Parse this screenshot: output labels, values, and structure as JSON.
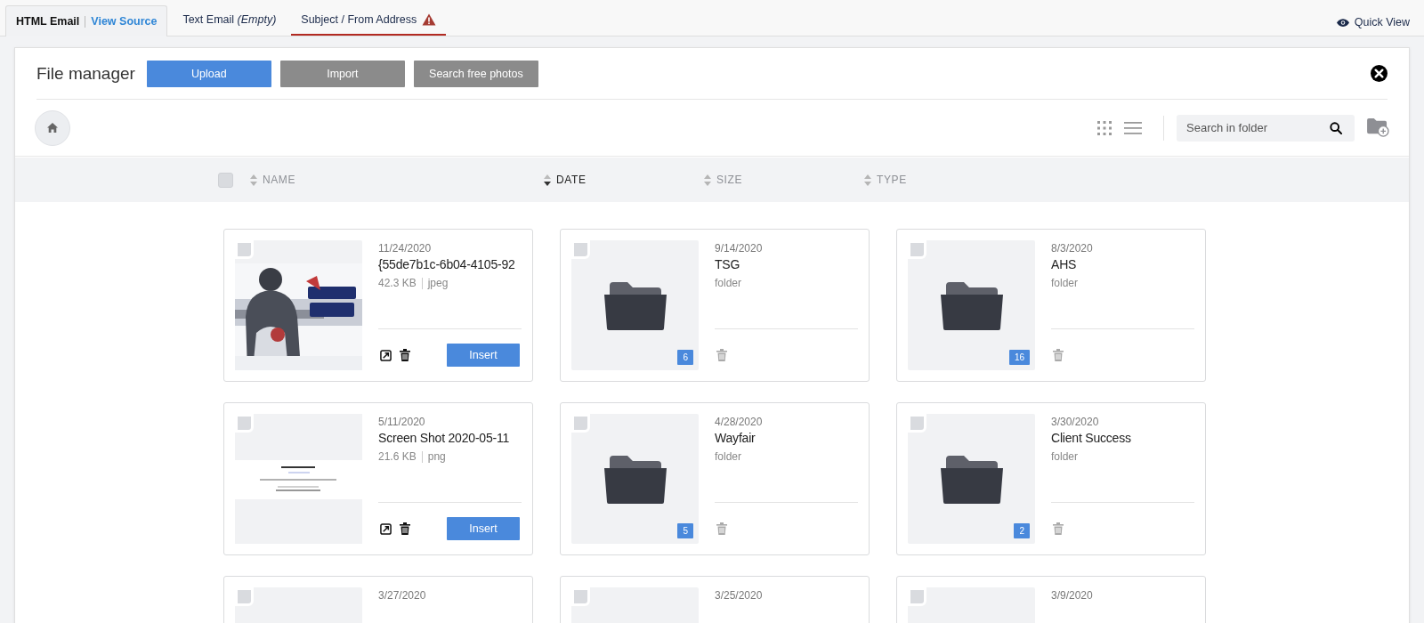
{
  "tabs": [
    {
      "label": "HTML Email",
      "link": "View Source",
      "selected": true,
      "warning": false
    },
    {
      "label": "Text Email *(Empty)*",
      "selected": false,
      "warning": false
    },
    {
      "label": "Subject / From Address",
      "selected": false,
      "warning": true
    }
  ],
  "quick_view": "Quick View",
  "file_manager": {
    "title": "File manager",
    "buttons": [
      {
        "label": "Upload",
        "kind": "primary"
      },
      {
        "label": "Import",
        "kind": "secondary"
      },
      {
        "label": "Search free photos",
        "kind": "secondary"
      }
    ],
    "search": {
      "placeholder": "Search in folder"
    },
    "select_all": {
      "checked": false
    },
    "columns": [
      {
        "label": "NAME",
        "selected": false
      },
      {
        "label": "DATE",
        "selected": true
      },
      {
        "label": "SIZE",
        "selected": false
      },
      {
        "label": "TYPE",
        "selected": false
      }
    ],
    "items": [
      {
        "kind": "file",
        "checked": false,
        "date": "11/24/2020",
        "name": "{55de7b1c-6b04-4105-92",
        "size": "42.3 KB",
        "type": "jpeg",
        "action": "Insert"
      },
      {
        "kind": "folder",
        "checked": false,
        "date": "9/14/2020",
        "name": "TSG",
        "type": "folder",
        "count": "6"
      },
      {
        "kind": "folder",
        "checked": false,
        "date": "8/3/2020",
        "name": "AHS",
        "type": "folder",
        "count": "16"
      },
      {
        "kind": "file",
        "checked": false,
        "date": "5/11/2020",
        "name": "Screen Shot 2020-05-11",
        "size": "21.6 KB",
        "type": "png",
        "action": "Insert"
      },
      {
        "kind": "folder",
        "checked": false,
        "date": "4/28/2020",
        "name": "Wayfair",
        "type": "folder",
        "count": "5"
      },
      {
        "kind": "folder",
        "checked": false,
        "date": "3/30/2020",
        "name": "Client Success",
        "type": "folder",
        "count": "2"
      },
      {
        "kind": "partial",
        "checked": false,
        "date": "3/27/2020"
      },
      {
        "kind": "partial",
        "checked": false,
        "date": "3/25/2020"
      },
      {
        "kind": "partial",
        "checked": false,
        "date": "3/9/2020"
      }
    ]
  }
}
